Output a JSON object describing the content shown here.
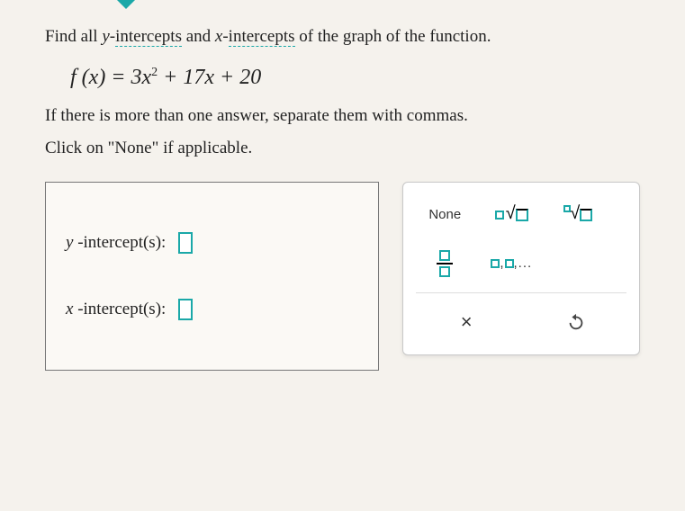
{
  "prompt_prefix": "Find all ",
  "prompt_y": "y",
  "prompt_dash": "-",
  "prompt_intercepts1": "intercepts",
  "prompt_and": " and ",
  "prompt_x": "x",
  "prompt_intercepts2": "intercepts",
  "prompt_suffix": " of the graph of the function.",
  "equation": {
    "lhs": "f (x) = ",
    "a": "3",
    "var1": "x",
    "exp": "2",
    "plus1": " + 17",
    "var2": "x",
    "plus2": " + 20"
  },
  "instruction1": "If there is more than one answer, separate them with commas.",
  "instruction2": "Click on \"None\" if applicable.",
  "answers": {
    "y_label_var": "y",
    "y_label_text": " -intercept(s):",
    "x_label_var": "x",
    "x_label_text": " -intercept(s):"
  },
  "keypad": {
    "none_label": "None",
    "list_dots": ",...",
    "cross_glyph": "×"
  }
}
